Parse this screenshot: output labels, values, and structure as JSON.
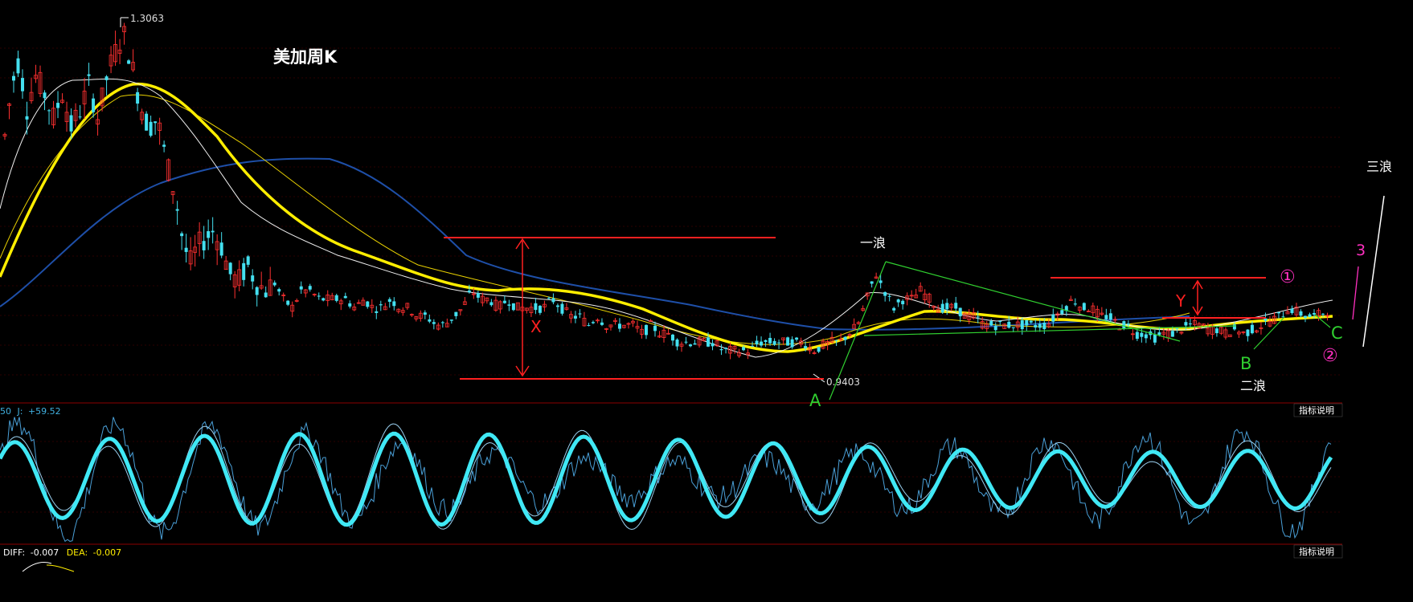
{
  "chart_title": "美加周K",
  "price_high_label": "1.3063",
  "price_low_label": "0.9403",
  "annotations": {
    "x": "X",
    "y": "Y",
    "a": "A",
    "b": "B",
    "c": "C",
    "wave1": "一浪",
    "wave2": "二浪",
    "wave3": "三浪",
    "circle1": "①",
    "circle2": "②",
    "three": "3"
  },
  "kdj_header": {
    "prefix": "50",
    "j_label": "J:",
    "j_value": "+59.52"
  },
  "macd_header": {
    "diff_label": "DIFF:",
    "diff_value": "-0.007",
    "dea_label": "DEA:",
    "dea_value": "-0.007"
  },
  "indicator_button": "指标说明",
  "colors": {
    "background": "#000000",
    "up": "#ff3030",
    "down": "#44e0f0",
    "ma_yellow": "#ffee00",
    "ma_blue": "#1e4fa8",
    "trend_green": "#30d030",
    "annotation_red": "#ff2020",
    "magenta": "#ff30c0",
    "kdj_main": "#40e8f5",
    "kdj_thin": "#4aa0d8",
    "divider": "#8b0000"
  },
  "chart_data": {
    "type": "candlestick",
    "title": "美加周K",
    "ylim": [
      0.9,
      1.32
    ],
    "price_max": 1.3063,
    "price_min": 0.9403,
    "path_points": [
      [
        0,
        1.19
      ],
      [
        8,
        1.25
      ],
      [
        16,
        1.28
      ],
      [
        24,
        1.22
      ],
      [
        34,
        1.26
      ],
      [
        44,
        1.24
      ],
      [
        54,
        1.21
      ],
      [
        64,
        1.24
      ],
      [
        74,
        1.2
      ],
      [
        84,
        1.22
      ],
      [
        94,
        1.25
      ],
      [
        104,
        1.21
      ],
      [
        114,
        1.26
      ],
      [
        124,
        1.29
      ],
      [
        132,
        1.31
      ],
      [
        140,
        1.28
      ],
      [
        150,
        1.23
      ],
      [
        160,
        1.2
      ],
      [
        170,
        1.21
      ],
      [
        180,
        1.16
      ],
      [
        190,
        1.12
      ],
      [
        198,
        1.07
      ],
      [
        206,
        1.04
      ],
      [
        214,
        1.06
      ],
      [
        222,
        1.07
      ],
      [
        232,
        1.08
      ],
      [
        242,
        1.06
      ],
      [
        250,
        1.03
      ],
      [
        260,
        1.02
      ],
      [
        270,
        1.04
      ],
      [
        280,
        1.02
      ],
      [
        290,
        1.01
      ],
      [
        300,
        1.02
      ],
      [
        310,
        1.0
      ],
      [
        320,
        0.99
      ],
      [
        330,
        1.01
      ],
      [
        340,
        1.01
      ],
      [
        350,
        1.0
      ],
      [
        360,
        1.0
      ],
      [
        370,
        1.0
      ],
      [
        380,
        1.0
      ],
      [
        390,
        0.99
      ],
      [
        400,
        1.0
      ],
      [
        410,
        0.99
      ],
      [
        420,
        0.99
      ],
      [
        430,
        1.0
      ],
      [
        440,
        0.99
      ],
      [
        450,
        0.99
      ],
      [
        460,
        0.98
      ],
      [
        470,
        0.98
      ],
      [
        480,
        0.97
      ],
      [
        490,
        0.97
      ],
      [
        500,
        0.98
      ],
      [
        510,
        0.99
      ],
      [
        520,
        1.01
      ],
      [
        530,
        1.0
      ],
      [
        540,
        1.0
      ],
      [
        550,
        0.99
      ],
      [
        560,
        1.0
      ],
      [
        570,
        0.99
      ],
      [
        580,
        0.99
      ],
      [
        590,
        0.99
      ],
      [
        600,
        0.99
      ],
      [
        610,
        1.0
      ],
      [
        620,
        0.99
      ],
      [
        630,
        0.98
      ],
      [
        640,
        0.98
      ],
      [
        650,
        0.97
      ],
      [
        660,
        0.98
      ],
      [
        670,
        0.97
      ],
      [
        680,
        0.97
      ],
      [
        690,
        0.97
      ],
      [
        700,
        0.97
      ],
      [
        710,
        0.96
      ],
      [
        720,
        0.97
      ],
      [
        730,
        0.96
      ],
      [
        740,
        0.96
      ],
      [
        750,
        0.95
      ],
      [
        760,
        0.95
      ],
      [
        770,
        0.95
      ],
      [
        780,
        0.95
      ],
      [
        790,
        0.95
      ],
      [
        800,
        0.94
      ],
      [
        810,
        0.94
      ],
      [
        820,
        0.94
      ],
      [
        830,
        0.94
      ],
      [
        840,
        0.95
      ],
      [
        850,
        0.95
      ],
      [
        860,
        0.95
      ],
      [
        870,
        0.95
      ],
      [
        880,
        0.95
      ],
      [
        890,
        0.95
      ],
      [
        900,
        0.94
      ],
      [
        910,
        0.945
      ],
      [
        920,
        0.95
      ],
      [
        930,
        0.95
      ],
      [
        940,
        0.96
      ],
      [
        950,
        0.97
      ],
      [
        960,
        1.0
      ],
      [
        970,
        1.03
      ],
      [
        980,
        1.01
      ],
      [
        990,
        0.99
      ],
      [
        1000,
        1.0
      ],
      [
        1010,
        1.0
      ],
      [
        1020,
        1.01
      ],
      [
        1030,
        1.0
      ],
      [
        1040,
        0.99
      ],
      [
        1050,
        0.99
      ],
      [
        1060,
        0.99
      ],
      [
        1070,
        0.98
      ],
      [
        1080,
        0.98
      ],
      [
        1090,
        0.97
      ],
      [
        1100,
        0.97
      ],
      [
        1110,
        0.97
      ],
      [
        1120,
        0.97
      ],
      [
        1130,
        0.97
      ],
      [
        1140,
        0.97
      ],
      [
        1150,
        0.97
      ],
      [
        1160,
        0.97
      ],
      [
        1170,
        0.98
      ],
      [
        1180,
        0.99
      ],
      [
        1190,
        1.0
      ],
      [
        1200,
        0.99
      ],
      [
        1210,
        0.99
      ],
      [
        1220,
        0.98
      ],
      [
        1230,
        0.98
      ],
      [
        1240,
        0.97
      ],
      [
        1250,
        0.97
      ],
      [
        1260,
        0.96
      ],
      [
        1270,
        0.96
      ],
      [
        1280,
        0.955
      ],
      [
        1290,
        0.96
      ],
      [
        1300,
        0.96
      ],
      [
        1310,
        0.965
      ],
      [
        1320,
        0.97
      ],
      [
        1330,
        0.97
      ],
      [
        1340,
        0.965
      ],
      [
        1350,
        0.965
      ],
      [
        1360,
        0.96
      ],
      [
        1370,
        0.965
      ],
      [
        1380,
        0.96
      ],
      [
        1390,
        0.965
      ],
      [
        1400,
        0.97
      ],
      [
        1410,
        0.975
      ],
      [
        1420,
        0.98
      ],
      [
        1430,
        0.99
      ],
      [
        1440,
        0.985
      ],
      [
        1450,
        0.98
      ],
      [
        1460,
        0.98
      ],
      [
        1470,
        0.985
      ],
      [
        1478,
        0.99
      ]
    ]
  }
}
